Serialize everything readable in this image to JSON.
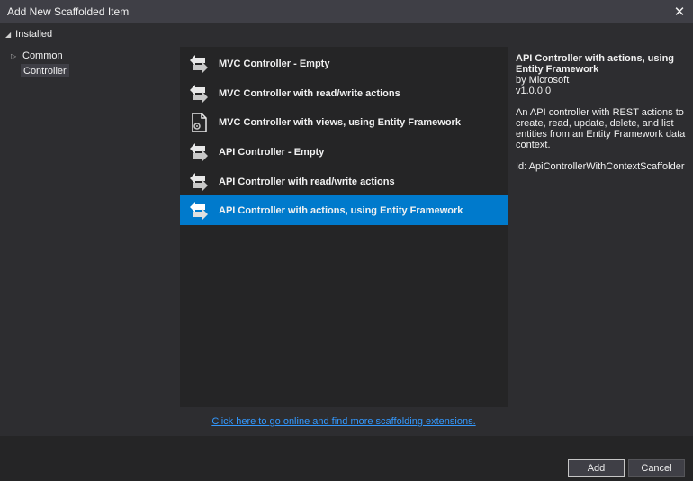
{
  "window": {
    "title": "Add New Scaffolded Item",
    "close_glyph": "✕"
  },
  "tree": {
    "root_label": "Installed",
    "items": [
      {
        "label": "Common"
      },
      {
        "label": "Controller"
      }
    ]
  },
  "templates": [
    {
      "label": "MVC Controller - Empty",
      "icon": "controller-icon"
    },
    {
      "label": "MVC Controller with read/write actions",
      "icon": "controller-icon"
    },
    {
      "label": "MVC Controller with views, using Entity Framework",
      "icon": "document-gear-icon"
    },
    {
      "label": "API Controller - Empty",
      "icon": "controller-icon"
    },
    {
      "label": "API Controller with read/write actions",
      "icon": "controller-icon"
    },
    {
      "label": "API Controller with actions, using Entity Framework",
      "icon": "controller-icon",
      "selected": true
    }
  ],
  "details": {
    "name": "API Controller with actions, using Entity Framework",
    "author": "by Microsoft",
    "version": "v1.0.0.0",
    "description": "An API controller with REST actions to create, read, update, delete, and list entities from an Entity Framework data context.",
    "id_text": "Id: ApiControllerWithContextScaffolder"
  },
  "online_link": "Click here to go online and find more scaffolding extensions.",
  "buttons": {
    "add": "Add",
    "cancel": "Cancel"
  },
  "colors": {
    "accent": "#007acc",
    "link": "#3399ff",
    "background": "#2d2d30"
  }
}
